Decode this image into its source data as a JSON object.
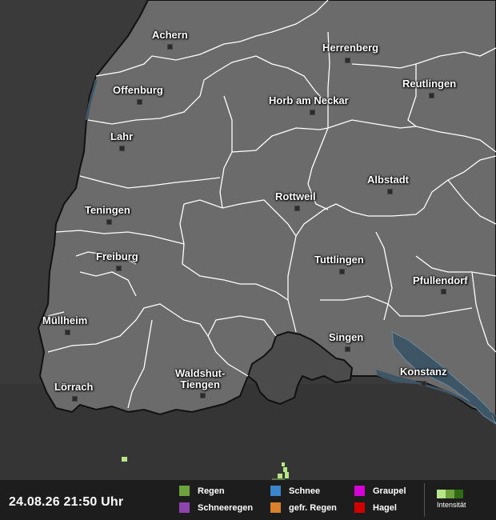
{
  "timestamp": "24.08.26 21:50 Uhr",
  "cities": [
    {
      "name": "Achern",
      "name_line2": ""
    },
    {
      "name": "Herrenberg",
      "name_line2": ""
    },
    {
      "name": "Offenburg",
      "name_line2": ""
    },
    {
      "name": "Reutlingen",
      "name_line2": ""
    },
    {
      "name": "Horb am Neckar",
      "name_line2": ""
    },
    {
      "name": "Lahr",
      "name_line2": ""
    },
    {
      "name": "Albstadt",
      "name_line2": ""
    },
    {
      "name": "Rottweil",
      "name_line2": ""
    },
    {
      "name": "Teningen",
      "name_line2": ""
    },
    {
      "name": "Freiburg",
      "name_line2": ""
    },
    {
      "name": "Tuttlingen",
      "name_line2": ""
    },
    {
      "name": "Pfullendorf",
      "name_line2": ""
    },
    {
      "name": "Müllheim",
      "name_line2": ""
    },
    {
      "name": "Singen",
      "name_line2": ""
    },
    {
      "name": "Konstanz",
      "name_line2": ""
    },
    {
      "name": "Waldshut-",
      "name_line2": "Tiengen"
    },
    {
      "name": "Lörrach",
      "name_line2": ""
    }
  ],
  "legend": {
    "items": [
      {
        "label": "Regen",
        "color": "#6ea23c"
      },
      {
        "label": "Schneeregen",
        "color": "#8e44ad"
      },
      {
        "label": "Schnee",
        "color": "#3a86c8"
      },
      {
        "label": "gefr. Regen",
        "color": "#d9822b"
      },
      {
        "label": "Graupel",
        "color": "#d400d4"
      },
      {
        "label": "Hagel",
        "color": "#d00000"
      }
    ],
    "intensity_label": "Intensität",
    "intensity_colors": [
      "#b7e58a",
      "#6ea23c",
      "#2f6b12"
    ]
  },
  "map_colors": {
    "land": "#6b6b6b",
    "outside": "#3a3a3a",
    "switzerland": "#4b4b4b",
    "water": "#3e5566",
    "borders": "#ffffff",
    "rain_light": "#b7e58a",
    "rain_medium": "#5f7d43"
  }
}
